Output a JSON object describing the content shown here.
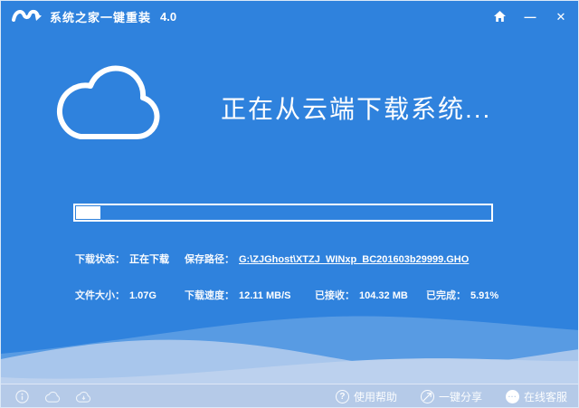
{
  "window": {
    "title": "系统之家一键重装",
    "version": "4.0"
  },
  "titlebar": {
    "minimize_glyph": "—",
    "close_glyph": "✕"
  },
  "main": {
    "heading": "正在从云端下载系统...",
    "progress_percent": 5.91
  },
  "stats": {
    "download_status": {
      "label": "下载状态：",
      "value": "正在下载"
    },
    "save_path": {
      "label": "保存路径：",
      "value": "G:\\ZJGhost\\XTZJ_WINxp_BC201603b29999.GHO"
    },
    "file_size": {
      "label": "文件大小：",
      "value": "1.07G"
    },
    "download_speed": {
      "label": "下载速度：",
      "value": "12.11 MB/S"
    },
    "received": {
      "label": "已接收：",
      "value": "104.32 MB"
    },
    "completed": {
      "label": "已完成：",
      "value": "5.91%"
    }
  },
  "footer": {
    "left_icons": [
      "info-icon",
      "cloud-icon",
      "cloud-download-icon"
    ],
    "links": [
      {
        "label": "使用帮助",
        "glyph": "?"
      },
      {
        "label": "一键分享",
        "glyph": "share"
      },
      {
        "label": "在线客服",
        "glyph": "···"
      }
    ]
  },
  "colors": {
    "background": "#2f82dd",
    "footer_bar": "#b5cae8",
    "wave_light": "#a8c6ec",
    "wave_lighter": "#bcd1ee",
    "text": "#ffffff"
  }
}
